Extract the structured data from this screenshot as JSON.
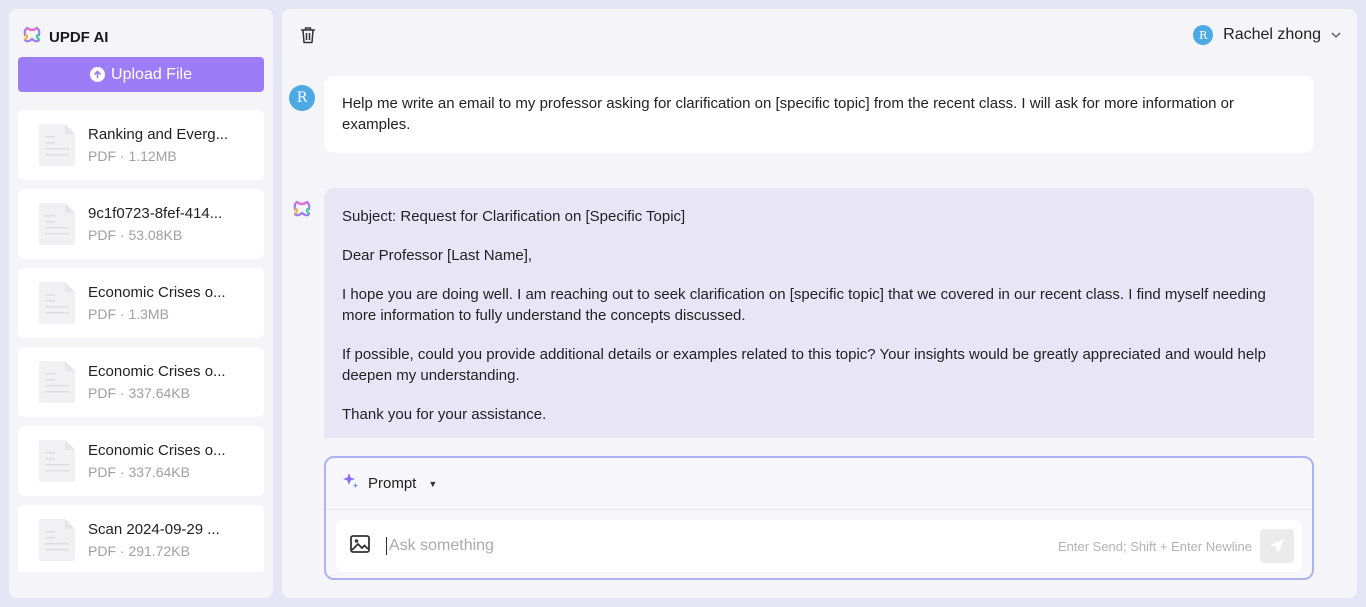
{
  "app": {
    "brand": "UPDF AI",
    "upload_label": "Upload File"
  },
  "files": [
    {
      "name": "Ranking and Everg...",
      "meta": "PDF · 1.12MB"
    },
    {
      "name": "9c1f0723-8fef-414...",
      "meta": "PDF · 53.08KB"
    },
    {
      "name": "Economic Crises o...",
      "meta": "PDF · 1.3MB"
    },
    {
      "name": "Economic Crises o...",
      "meta": "PDF · 337.64KB"
    },
    {
      "name": "Economic Crises o...",
      "meta": "PDF · 337.64KB"
    },
    {
      "name": "Scan 2024-09-29 ...",
      "meta": "PDF · 291.72KB"
    }
  ],
  "header": {
    "user_initial": "R",
    "user_name": "Rachel zhong"
  },
  "chat": {
    "user_initial": "R",
    "user_message": "Help me write an email to my professor asking for clarification on [specific topic] from the recent class. I will ask for more information or examples.",
    "ai_paragraphs": [
      "Subject: Request for Clarification on [Specific Topic]",
      "Dear Professor [Last Name],",
      "I hope you are doing well. I am reaching out to seek clarification on [specific topic] that we covered in our recent class. I find myself needing more information to fully understand the concepts discussed.",
      "If possible, could you provide additional details or examples related to this topic? Your insights would be greatly appreciated and would help deepen my understanding.",
      "Thank you for your assistance."
    ]
  },
  "composer": {
    "prompt_label": "Prompt",
    "placeholder": "Ask something",
    "hint": "Enter Send; Shift + Enter Newline"
  },
  "colors": {
    "accent": "#9d7cf7",
    "avatar": "#4da9e3",
    "ai_bubble": "#e8e6f6",
    "composer_border": "#a9b4f0"
  }
}
